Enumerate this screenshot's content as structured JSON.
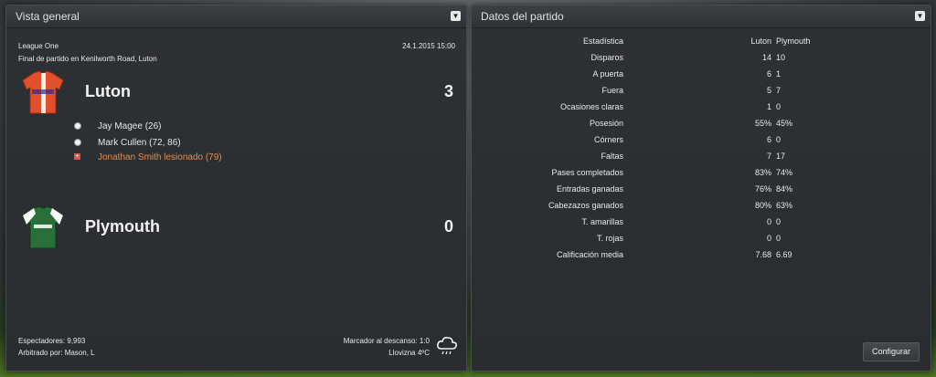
{
  "left_panel": {
    "title": "Vista general",
    "competition": "League One",
    "datetime": "24.1.2015 15:00",
    "result_line": "Final de partido en Kenilworth Road, Luton",
    "home": {
      "name": "Luton",
      "score": "3",
      "kit_colors": [
        "#e0502a",
        "#ffffff"
      ]
    },
    "away": {
      "name": "Plymouth",
      "score": "0",
      "kit_colors": [
        "#2a6e3a",
        "#ffffff"
      ]
    },
    "events": [
      {
        "text": "Jay Magee (26)",
        "type": "goal"
      },
      {
        "text": "Mark Cullen (72, 86)",
        "type": "goal"
      },
      {
        "text": "Jonathan Smith lesionado (79)",
        "type": "injury"
      }
    ],
    "attendance": "Espectadores: 9,993",
    "referee": "Arbitrado por: Mason, L",
    "halftime": "Marcador al descanso: 1:0",
    "weather": "Llovizna 4ºC",
    "weather_icon": "rain-cloud-icon"
  },
  "right_panel": {
    "title": "Datos del partido",
    "header": {
      "label": "Estadística",
      "home": "Luton",
      "away": "Plymouth"
    },
    "stats": [
      {
        "label": "Disparos",
        "home": "14",
        "away": "10"
      },
      {
        "label": "A puerta",
        "home": "6",
        "away": "1"
      },
      {
        "label": "Fuera",
        "home": "5",
        "away": "7"
      },
      {
        "label": "Ocasiones claras",
        "home": "1",
        "away": "0"
      },
      {
        "label": "Posesión",
        "home": "55%",
        "away": "45%"
      },
      {
        "label": "Córners",
        "home": "6",
        "away": "0"
      },
      {
        "label": "Faltas",
        "home": "7",
        "away": "17"
      },
      {
        "label": "Pases completados",
        "home": "83%",
        "away": "74%"
      },
      {
        "label": "Entradas ganadas",
        "home": "76%",
        "away": "84%"
      },
      {
        "label": "Cabezazos ganados",
        "home": "80%",
        "away": "63%"
      },
      {
        "label": "T. amarillas",
        "home": "0",
        "away": "0"
      },
      {
        "label": "T. rojas",
        "home": "0",
        "away": "0"
      },
      {
        "label": "Calificación media",
        "home": "7.68",
        "away": "6.69"
      }
    ],
    "configure_label": "Configurar"
  }
}
